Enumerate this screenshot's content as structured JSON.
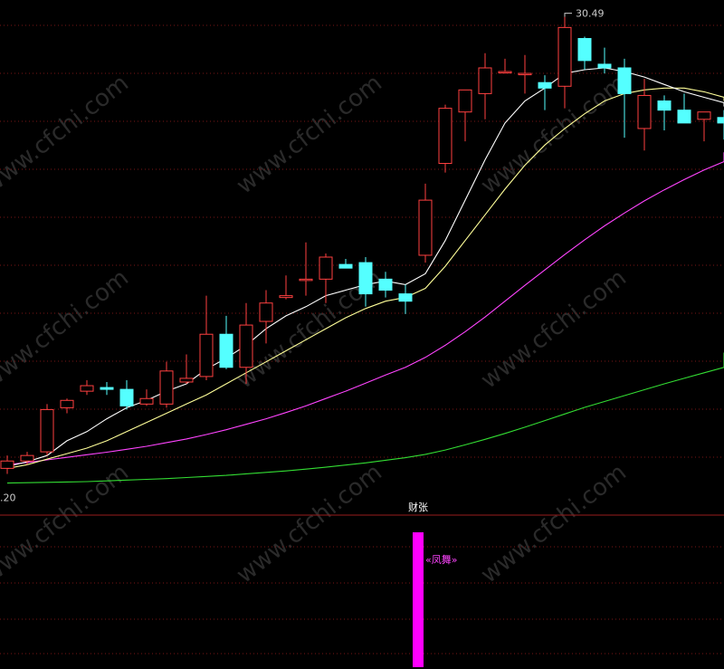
{
  "watermark": "www.cfchi.com",
  "chart_data": {
    "type": "candlestick",
    "price_high_label": "30.49",
    "price_low_label": ".20",
    "grid": true,
    "colors": {
      "up": "#ff4040",
      "down": "#54ffff",
      "ma_short": "#ffffff",
      "ma_mid": "#ffff99",
      "ma_long": "#ff44ff",
      "ma_longest": "#33dd33",
      "grid": "#7a1616",
      "indicator_bar": "#ff00ff",
      "divider": "#9a1c1c"
    },
    "candles": [
      {
        "o": 18.2,
        "h": 18.55,
        "l": 18.05,
        "c": 18.4
      },
      {
        "o": 18.4,
        "h": 18.65,
        "l": 18.3,
        "c": 18.55
      },
      {
        "o": 18.65,
        "h": 19.95,
        "l": 18.55,
        "c": 19.8
      },
      {
        "o": 19.85,
        "h": 20.1,
        "l": 19.7,
        "c": 20.05
      },
      {
        "o": 20.3,
        "h": 20.6,
        "l": 20.2,
        "c": 20.45
      },
      {
        "o": 20.4,
        "h": 20.55,
        "l": 20.2,
        "c": 20.35
      },
      {
        "o": 20.35,
        "h": 20.6,
        "l": 19.8,
        "c": 19.9
      },
      {
        "o": 19.95,
        "h": 20.35,
        "l": 19.9,
        "c": 20.1
      },
      {
        "o": 19.95,
        "h": 21.1,
        "l": 19.85,
        "c": 20.85
      },
      {
        "o": 20.55,
        "h": 21.3,
        "l": 20.5,
        "c": 20.65
      },
      {
        "o": 20.7,
        "h": 22.9,
        "l": 20.6,
        "c": 21.85
      },
      {
        "o": 21.85,
        "h": 22.35,
        "l": 20.9,
        "c": 20.95
      },
      {
        "o": 20.95,
        "h": 22.7,
        "l": 20.5,
        "c": 22.1
      },
      {
        "o": 22.2,
        "h": 23.05,
        "l": 21.6,
        "c": 22.7
      },
      {
        "o": 22.85,
        "h": 23.45,
        "l": 22.8,
        "c": 22.9
      },
      {
        "o": 23.35,
        "h": 24.35,
        "l": 22.9,
        "c": 23.35
      },
      {
        "o": 23.35,
        "h": 24.05,
        "l": 22.7,
        "c": 23.95
      },
      {
        "o": 23.75,
        "h": 23.9,
        "l": 23.65,
        "c": 23.65
      },
      {
        "o": 23.8,
        "h": 23.95,
        "l": 22.6,
        "c": 22.95
      },
      {
        "o": 23.35,
        "h": 23.55,
        "l": 22.85,
        "c": 23.05
      },
      {
        "o": 22.95,
        "h": 23.2,
        "l": 22.4,
        "c": 22.75
      },
      {
        "o": 24.0,
        "h": 25.95,
        "l": 23.8,
        "c": 25.5
      },
      {
        "o": 26.5,
        "h": 28.1,
        "l": 26.25,
        "c": 28.0
      },
      {
        "o": 27.9,
        "h": 28.2,
        "l": 27.1,
        "c": 28.5
      },
      {
        "o": 28.4,
        "h": 29.5,
        "l": 27.7,
        "c": 29.1
      },
      {
        "o": 29.0,
        "h": 29.35,
        "l": 28.95,
        "c": 29.0
      },
      {
        "o": 28.95,
        "h": 29.45,
        "l": 28.4,
        "c": 28.95
      },
      {
        "o": 28.7,
        "h": 28.9,
        "l": 27.95,
        "c": 28.55
      },
      {
        "o": 28.6,
        "h": 30.49,
        "l": 28.0,
        "c": 30.2
      },
      {
        "o": 29.9,
        "h": 29.95,
        "l": 29.05,
        "c": 29.3
      },
      {
        "o": 29.2,
        "h": 29.65,
        "l": 28.95,
        "c": 29.1
      },
      {
        "o": 29.1,
        "h": 29.35,
        "l": 27.2,
        "c": 28.4
      },
      {
        "o": 27.45,
        "h": 28.8,
        "l": 26.85,
        "c": 28.35
      },
      {
        "o": 28.2,
        "h": 28.35,
        "l": 27.4,
        "c": 27.95
      },
      {
        "o": 27.95,
        "h": 28.4,
        "l": 27.7,
        "c": 27.6
      },
      {
        "o": 27.7,
        "h": 27.9,
        "l": 27.1,
        "c": 27.9
      },
      {
        "o": 27.75,
        "h": 27.95,
        "l": 27.15,
        "c": 27.6
      }
    ],
    "ma_short": [
      18.25,
      18.38,
      18.55,
      18.95,
      19.2,
      19.55,
      19.85,
      20.05,
      20.3,
      20.5,
      20.9,
      21.2,
      21.55,
      22.0,
      22.35,
      22.6,
      22.9,
      23.05,
      23.2,
      23.3,
      23.2,
      23.5,
      24.4,
      25.5,
      26.6,
      27.6,
      28.2,
      28.55,
      28.95,
      29.05,
      29.1,
      29.0,
      28.85,
      28.65,
      28.45,
      28.3,
      28.15
    ],
    "ma_mid": [
      18.2,
      18.3,
      18.45,
      18.6,
      18.75,
      18.95,
      19.2,
      19.45,
      19.7,
      19.95,
      20.2,
      20.5,
      20.8,
      21.1,
      21.4,
      21.7,
      22.0,
      22.3,
      22.55,
      22.75,
      22.85,
      23.1,
      23.7,
      24.4,
      25.1,
      25.8,
      26.45,
      27.0,
      27.45,
      27.85,
      28.2,
      28.4,
      28.5,
      28.55,
      28.55,
      28.45,
      28.3
    ],
    "ma_long": [
      18.3,
      18.36,
      18.43,
      18.5,
      18.57,
      18.64,
      18.72,
      18.8,
      18.9,
      19.0,
      19.12,
      19.25,
      19.4,
      19.55,
      19.72,
      19.9,
      20.1,
      20.3,
      20.52,
      20.74,
      20.95,
      21.22,
      21.55,
      21.92,
      22.32,
      22.75,
      23.18,
      23.6,
      24.02,
      24.42,
      24.8,
      25.15,
      25.48,
      25.78,
      26.06,
      26.32,
      26.55
    ],
    "ma_longest": [
      17.8,
      17.81,
      17.82,
      17.83,
      17.84,
      17.86,
      17.88,
      17.9,
      17.92,
      17.95,
      17.98,
      18.01,
      18.05,
      18.09,
      18.13,
      18.18,
      18.23,
      18.29,
      18.35,
      18.42,
      18.49,
      18.58,
      18.7,
      18.84,
      18.99,
      19.15,
      19.32,
      19.5,
      19.68,
      19.86,
      20.02,
      20.18,
      20.34,
      20.5,
      20.65,
      20.8,
      20.95
    ],
    "y_range": [
      17.1,
      30.8
    ],
    "indicator": {
      "title": "财张",
      "bar_index": 20,
      "bar_value": 1,
      "annotation": "«凤舞»"
    }
  }
}
